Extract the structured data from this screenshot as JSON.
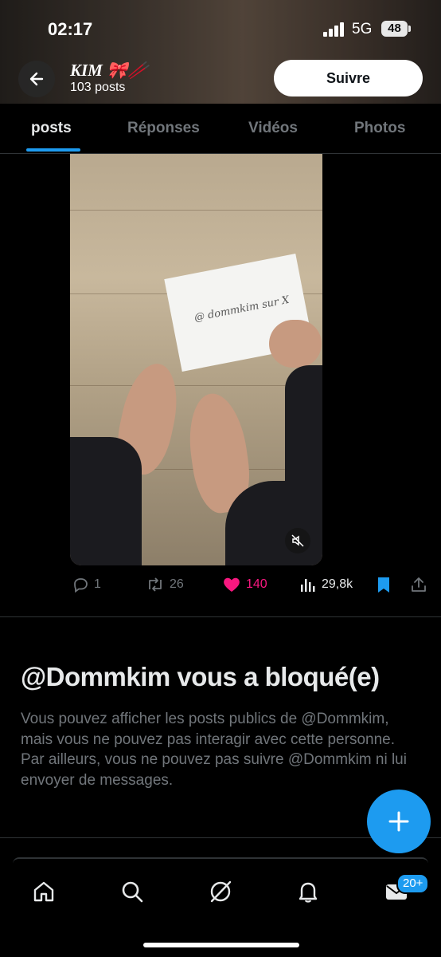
{
  "status_bar": {
    "time": "02:17",
    "network": "5G",
    "battery": "48"
  },
  "profile": {
    "name": "KIM 🎀🥢",
    "posts_count": "103 posts",
    "follow_label": "Suivre"
  },
  "tabs": [
    {
      "label": "posts",
      "active": true
    },
    {
      "label": "Réponses",
      "active": false
    },
    {
      "label": "Vidéos",
      "active": false
    },
    {
      "label": "Photos",
      "active": false
    }
  ],
  "media": {
    "paper_text": "@ dommkim sur X",
    "muted": true
  },
  "actions": {
    "replies": "1",
    "reposts": "26",
    "likes": "140",
    "views": "29,8k",
    "bookmarked": true
  },
  "blocked": {
    "title": "@Dommkim vous a bloqué(e)",
    "message": "Vous pouvez afficher les posts publics de @Dommkim, mais vous ne pouvez pas interagir avec cette personne. Par ailleurs, vous ne pouvez pas suivre @Dommkim ni lui envoyer de messages."
  },
  "nav": {
    "messages_badge": "20+"
  },
  "colors": {
    "accent": "#1d9bf0",
    "like": "#f91880",
    "muted_text": "#71767b",
    "text": "#e7e9ea"
  },
  "icons": [
    "back-arrow-icon",
    "mute-icon",
    "reply-icon",
    "repost-icon",
    "heart-icon",
    "views-icon",
    "bookmark-icon",
    "share-icon",
    "plus-icon",
    "home-icon",
    "search-icon",
    "grok-icon",
    "bell-icon",
    "mail-icon"
  ]
}
